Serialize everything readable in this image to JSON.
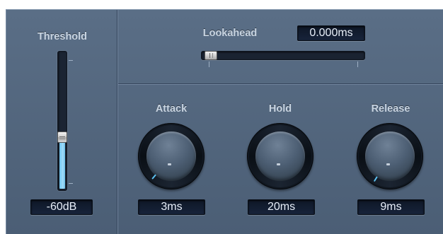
{
  "threshold": {
    "label": "Threshold",
    "value": "-60dB",
    "fill_fraction": 0.35
  },
  "lookahead": {
    "label": "Lookahead",
    "value": "0.000ms",
    "position_fraction": 0.0
  },
  "knobs": [
    {
      "label": "Attack",
      "value": "3ms"
    },
    {
      "label": "Hold",
      "value": "20ms"
    },
    {
      "label": "Release",
      "value": "9ms"
    }
  ],
  "colors": {
    "panel": "#546880",
    "accent": "#6fc5ee",
    "lcd_bg": "#121c2d"
  }
}
